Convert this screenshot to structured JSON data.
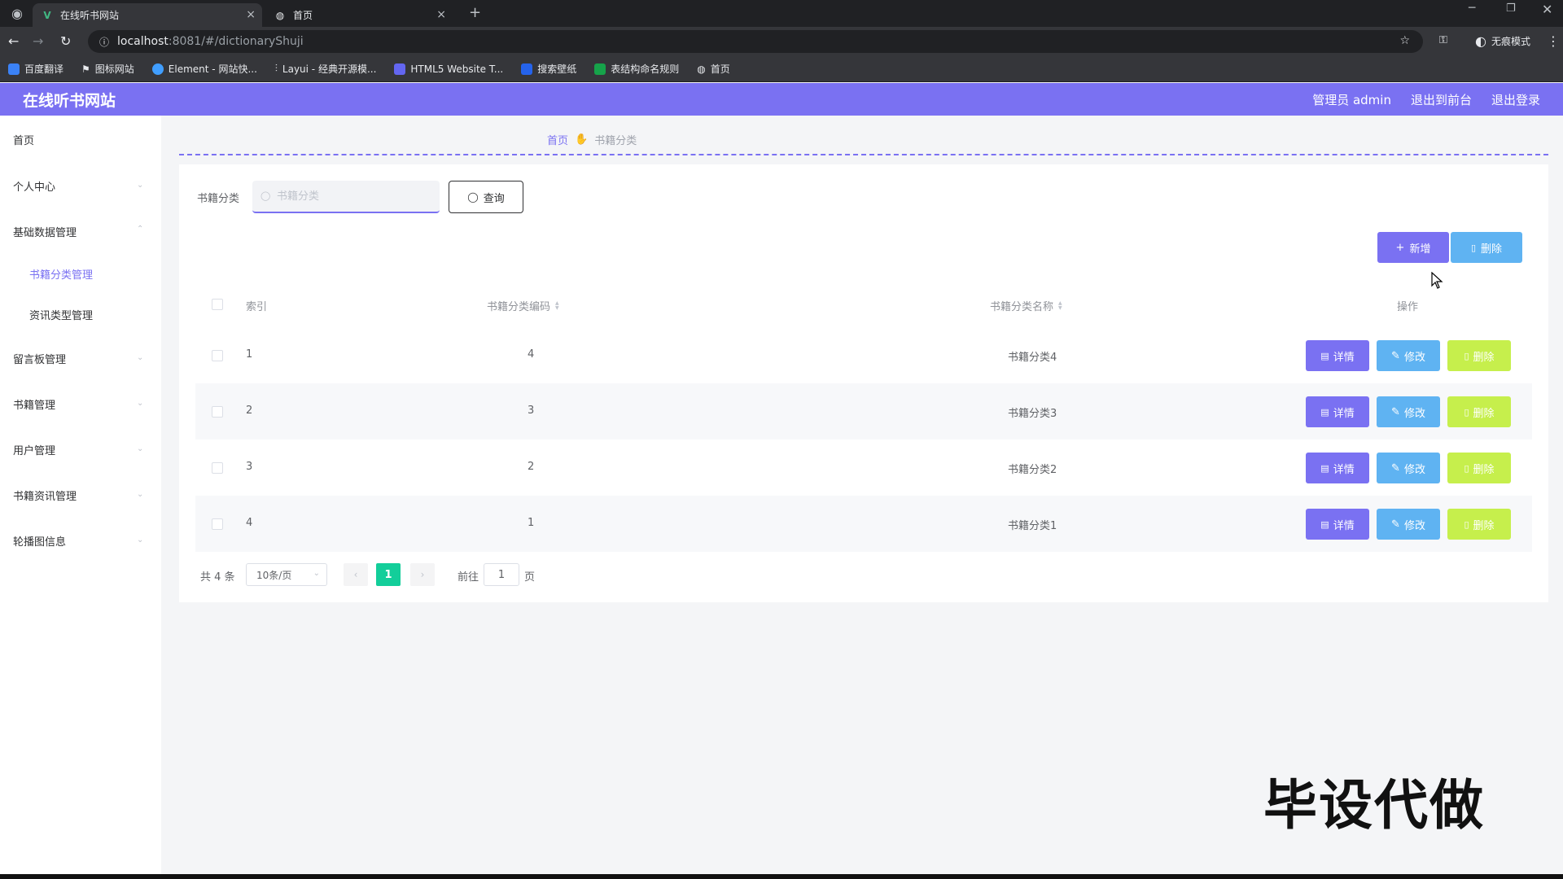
{
  "browser": {
    "tabs": [
      {
        "title": "在线听书网站",
        "close": "×"
      },
      {
        "title": "首页",
        "close": "×"
      }
    ],
    "new_tab": "+",
    "url_host": "localhost",
    "url_path": ":8081/#/dictionaryShuji",
    "incognito_label": "无痕模式",
    "bookmarks": [
      "百度翻译",
      "图标网站",
      "Element - 网站快...",
      "Layui - 经典开源模...",
      "HTML5 Website T...",
      "搜索壁纸",
      "表结构命名规则",
      "首页"
    ]
  },
  "header": {
    "title": "在线听书网站",
    "admin": "管理员 admin",
    "to_front": "退出到前台",
    "logout": "退出登录"
  },
  "sidebar": {
    "items": [
      "首页",
      "个人中心",
      "基础数据管理",
      "留言板管理",
      "书籍管理",
      "用户管理",
      "书籍资讯管理",
      "轮播图信息"
    ],
    "sub_items": [
      "书籍分类管理",
      "资讯类型管理"
    ]
  },
  "breadcrumb": {
    "home": "首页",
    "current": "书籍分类"
  },
  "search": {
    "label": "书籍分类",
    "placeholder": "书籍分类",
    "button": "查询"
  },
  "actions": {
    "add": "新增",
    "delete": "删除"
  },
  "table": {
    "headers": {
      "index": "索引",
      "code": "书籍分类编码",
      "name": "书籍分类名称",
      "ops": "操作"
    },
    "rows": [
      {
        "index": "1",
        "code": "4",
        "name": "书籍分类4"
      },
      {
        "index": "2",
        "code": "3",
        "name": "书籍分类3"
      },
      {
        "index": "3",
        "code": "2",
        "name": "书籍分类2"
      },
      {
        "index": "4",
        "code": "1",
        "name": "书籍分类1"
      }
    ],
    "row_buttons": {
      "detail": "详情",
      "edit": "修改",
      "delete": "删除"
    }
  },
  "pagination": {
    "total": "共 4 条",
    "page_size": "10条/页",
    "current": "1",
    "goto_label": "前往",
    "goto_value": "1",
    "page_unit": "页"
  },
  "watermark": "毕设代做",
  "colors": {
    "primary": "#7a71f2",
    "info": "#5fb3f2",
    "danger": "#c6ef4c",
    "pager_active": "#13ce9a"
  }
}
